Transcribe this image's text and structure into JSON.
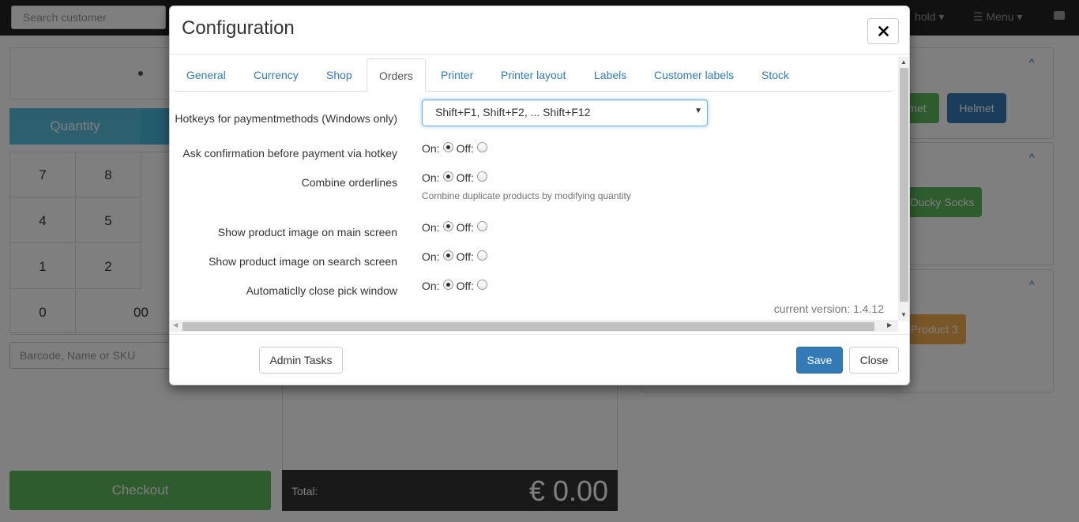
{
  "background": {
    "search_placeholder": "Search customer",
    "nav": {
      "hold_label": "hold",
      "menu_label": "Menu"
    },
    "quantity_tab": "Quantity",
    "keypad": [
      "7",
      "8",
      "4",
      "5",
      "1",
      "2",
      "0",
      "00"
    ],
    "barcode_placeholder": "Barcode, Name or SKU",
    "checkout_label": "Checkout",
    "total_label": "Total:",
    "total_value": "€ 0.00",
    "products": [
      "met",
      "Helmet",
      "Ducky Socks",
      "Product 3"
    ],
    "colors": {
      "topbar": "#222222",
      "quantity": "#5bc0de",
      "checkout": "#5cb85c",
      "product_green": "#5cb85c",
      "product_blue": "#337ab7",
      "product_orange": "#f0ad4e"
    }
  },
  "modal": {
    "title": "Configuration",
    "close_icon": "close-x-icon",
    "tabs": [
      {
        "label": "General",
        "active": false
      },
      {
        "label": "Currency",
        "active": false
      },
      {
        "label": "Shop",
        "active": false
      },
      {
        "label": "Orders",
        "active": true
      },
      {
        "label": "Printer",
        "active": false
      },
      {
        "label": "Printer layout",
        "active": false
      },
      {
        "label": "Labels",
        "active": false
      },
      {
        "label": "Customer labels",
        "active": false
      },
      {
        "label": "Stock",
        "active": false
      }
    ],
    "fields": {
      "hotkeys": {
        "label": "Hotkeys for paymentmethods (Windows only)",
        "value": "Shift+F1, Shift+F2, ... Shift+F12"
      },
      "on_label": "On:",
      "off_label": "Off:",
      "radios": [
        {
          "label": "Ask confirmation before payment via hotkey",
          "on": true
        },
        {
          "label": "Combine orderlines",
          "on": true,
          "help": "Combine duplicate products by modifying quantity"
        },
        {
          "label": "Show product image on main screen",
          "on": true
        },
        {
          "label": "Show product image on search screen",
          "on": true
        },
        {
          "label": "Automaticlly close pick window",
          "on": true
        }
      ]
    },
    "version_text": "current version: 1.4.12",
    "footer": {
      "admin_tasks": "Admin Tasks",
      "save": "Save",
      "close": "Close"
    }
  }
}
